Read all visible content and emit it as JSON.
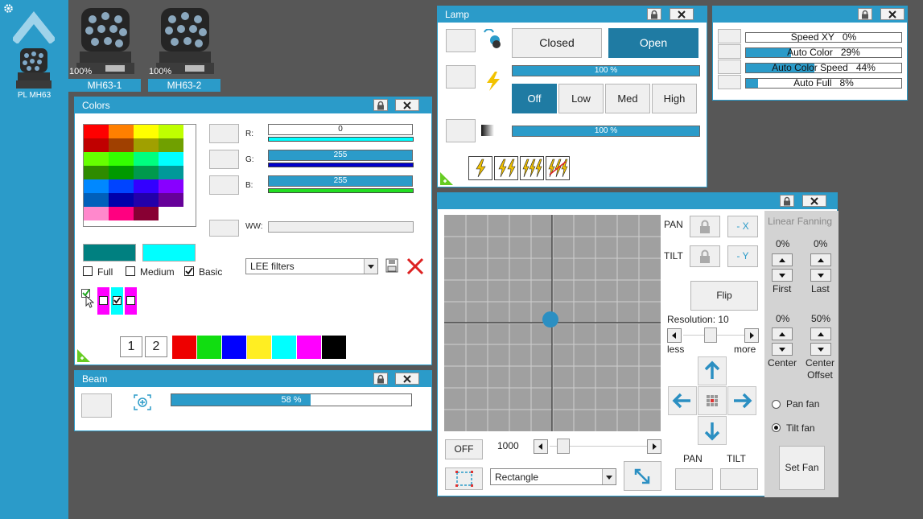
{
  "sidebar": {
    "fixture_label": "PL MH63"
  },
  "fixtures": [
    {
      "label": "MH63-1",
      "percent": "100%"
    },
    {
      "label": "MH63-2",
      "percent": "100%"
    }
  ],
  "colors_panel": {
    "title": "Colors",
    "channels": [
      {
        "label": "R:",
        "value": "0",
        "level": 0,
        "indicator": "#00ffff"
      },
      {
        "label": "G:",
        "value": "255",
        "level": 1,
        "indicator": "#0000cc"
      },
      {
        "label": "B:",
        "value": "255",
        "level": 1,
        "indicator": "#22dd22"
      }
    ],
    "ww_label": "WW:",
    "palette": [
      [
        "#ff0000",
        "#ff7f00",
        "#ffff00",
        "#bfff00"
      ],
      [
        "#c00000",
        "#a04000",
        "#a0a000",
        "#70a000"
      ],
      [
        "#66ff00",
        "#33ff00",
        "#00ff7f",
        "#00ffff"
      ],
      [
        "#2e8b00",
        "#009900",
        "#00994d",
        "#009999"
      ],
      [
        "#0088ff",
        "#0044ff",
        "#3300ff",
        "#8800ff"
      ],
      [
        "#0060bb",
        "#0000aa",
        "#2200aa",
        "#660099"
      ],
      [
        "#ff88cc",
        "#ff0080",
        "#880033",
        "#ffffff"
      ]
    ],
    "current_color": "#008080",
    "target_color": "#00ffff",
    "checkboxes": [
      {
        "label": "Full",
        "checked": false
      },
      {
        "label": "Medium",
        "checked": false
      },
      {
        "label": "Basic",
        "checked": true
      }
    ],
    "filter_select": "LEE filters",
    "preset_numbers": [
      "1",
      "2"
    ],
    "preset_colors": [
      "#ee0000",
      "#11dd11",
      "#0000ff",
      "#ffee22",
      "#00ffff",
      "#ff00ff",
      "#000000"
    ]
  },
  "beam_panel": {
    "title": "Beam",
    "value": "58 %",
    "level": 0.58
  },
  "lamp_panel": {
    "title": "Lamp",
    "closed_label": "Closed",
    "open_label": "Open",
    "bar1": "100 %",
    "bar1_level": 1,
    "power_options": [
      "Off",
      "Low",
      "Med",
      "High"
    ],
    "power_selected": "Off",
    "bar2": "100 %",
    "bar2_level": 1
  },
  "auto_panel": {
    "rows": [
      {
        "label": "Speed XY",
        "value": "0%",
        "level": 0
      },
      {
        "label": "Auto Color",
        "value": "29%",
        "level": 0.29
      },
      {
        "label": "Auto Color Speed",
        "value": "44%",
        "level": 0.44
      },
      {
        "label": "Auto Full",
        "value": "8%",
        "level": 0.08
      }
    ]
  },
  "position_panel": {
    "pan_label": "PAN",
    "tilt_label": "TILT",
    "minus_x": "- X",
    "minus_y": "- Y",
    "flip": "Flip",
    "resolution": "Resolution: 10",
    "less": "less",
    "more": "more",
    "off_label": "OFF",
    "speed_value": "1000",
    "shape_select": "Rectangle",
    "pan_bottom": "PAN",
    "tilt_bottom": "TILT",
    "fanning": {
      "title": "Linear Fanning",
      "first_value": "0%",
      "last_value": "0%",
      "first_label": "First",
      "last_label": "Last",
      "center_value": "0%",
      "offset_value": "50%",
      "center_label": "Center",
      "offset_label": "Center Offset",
      "pan_fan": "Pan fan",
      "tilt_fan": "Tilt fan",
      "tilt_fan_selected": true,
      "set_fan": "Set Fan"
    }
  },
  "colors": {
    "accent": "#2b9bc9",
    "accent_dark": "#1f7ba3",
    "background": "#575757"
  }
}
